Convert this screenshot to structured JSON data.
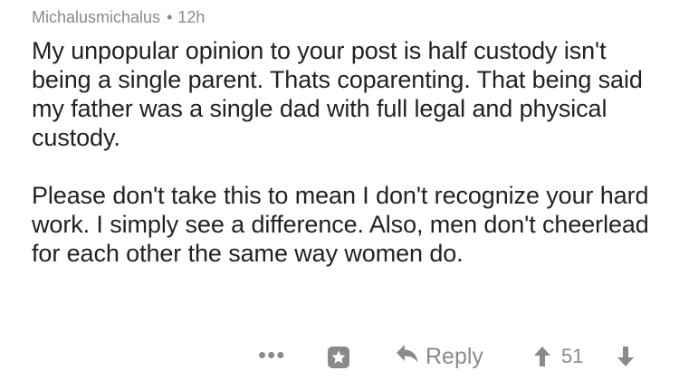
{
  "comment": {
    "author": "Michalusmichalus",
    "separator": "•",
    "age": "12h",
    "paragraphs": [
      "My unpopular opinion to your post is half custody isn't being a single parent. Thats coparenting. That being said my father was a single dad with full legal and physical custody.",
      "Please don't take this to mean I don't recognize your hard work. I simply see a difference. Also, men don't cheerlead for each other the same way women do."
    ]
  },
  "actions": {
    "more_label": "•••",
    "reply_label": "Reply",
    "score": "51",
    "icons": {
      "more": "more-icon",
      "award": "award-icon",
      "reply": "reply-icon",
      "upvote": "upvote-icon",
      "downvote": "downvote-icon"
    },
    "icon_color": "#8a8a8a"
  }
}
